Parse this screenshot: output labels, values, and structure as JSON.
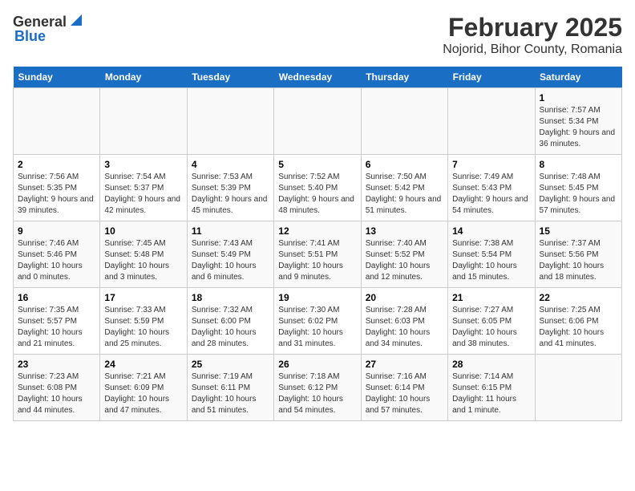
{
  "header": {
    "logo_general": "General",
    "logo_blue": "Blue",
    "title": "February 2025",
    "subtitle": "Nojorid, Bihor County, Romania"
  },
  "weekdays": [
    "Sunday",
    "Monday",
    "Tuesday",
    "Wednesday",
    "Thursday",
    "Friday",
    "Saturday"
  ],
  "weeks": [
    [
      {
        "day": "",
        "info": ""
      },
      {
        "day": "",
        "info": ""
      },
      {
        "day": "",
        "info": ""
      },
      {
        "day": "",
        "info": ""
      },
      {
        "day": "",
        "info": ""
      },
      {
        "day": "",
        "info": ""
      },
      {
        "day": "1",
        "info": "Sunrise: 7:57 AM\nSunset: 5:34 PM\nDaylight: 9 hours and 36 minutes."
      }
    ],
    [
      {
        "day": "2",
        "info": "Sunrise: 7:56 AM\nSunset: 5:35 PM\nDaylight: 9 hours and 39 minutes."
      },
      {
        "day": "3",
        "info": "Sunrise: 7:54 AM\nSunset: 5:37 PM\nDaylight: 9 hours and 42 minutes."
      },
      {
        "day": "4",
        "info": "Sunrise: 7:53 AM\nSunset: 5:39 PM\nDaylight: 9 hours and 45 minutes."
      },
      {
        "day": "5",
        "info": "Sunrise: 7:52 AM\nSunset: 5:40 PM\nDaylight: 9 hours and 48 minutes."
      },
      {
        "day": "6",
        "info": "Sunrise: 7:50 AM\nSunset: 5:42 PM\nDaylight: 9 hours and 51 minutes."
      },
      {
        "day": "7",
        "info": "Sunrise: 7:49 AM\nSunset: 5:43 PM\nDaylight: 9 hours and 54 minutes."
      },
      {
        "day": "8",
        "info": "Sunrise: 7:48 AM\nSunset: 5:45 PM\nDaylight: 9 hours and 57 minutes."
      }
    ],
    [
      {
        "day": "9",
        "info": "Sunrise: 7:46 AM\nSunset: 5:46 PM\nDaylight: 10 hours and 0 minutes."
      },
      {
        "day": "10",
        "info": "Sunrise: 7:45 AM\nSunset: 5:48 PM\nDaylight: 10 hours and 3 minutes."
      },
      {
        "day": "11",
        "info": "Sunrise: 7:43 AM\nSunset: 5:49 PM\nDaylight: 10 hours and 6 minutes."
      },
      {
        "day": "12",
        "info": "Sunrise: 7:41 AM\nSunset: 5:51 PM\nDaylight: 10 hours and 9 minutes."
      },
      {
        "day": "13",
        "info": "Sunrise: 7:40 AM\nSunset: 5:52 PM\nDaylight: 10 hours and 12 minutes."
      },
      {
        "day": "14",
        "info": "Sunrise: 7:38 AM\nSunset: 5:54 PM\nDaylight: 10 hours and 15 minutes."
      },
      {
        "day": "15",
        "info": "Sunrise: 7:37 AM\nSunset: 5:56 PM\nDaylight: 10 hours and 18 minutes."
      }
    ],
    [
      {
        "day": "16",
        "info": "Sunrise: 7:35 AM\nSunset: 5:57 PM\nDaylight: 10 hours and 21 minutes."
      },
      {
        "day": "17",
        "info": "Sunrise: 7:33 AM\nSunset: 5:59 PM\nDaylight: 10 hours and 25 minutes."
      },
      {
        "day": "18",
        "info": "Sunrise: 7:32 AM\nSunset: 6:00 PM\nDaylight: 10 hours and 28 minutes."
      },
      {
        "day": "19",
        "info": "Sunrise: 7:30 AM\nSunset: 6:02 PM\nDaylight: 10 hours and 31 minutes."
      },
      {
        "day": "20",
        "info": "Sunrise: 7:28 AM\nSunset: 6:03 PM\nDaylight: 10 hours and 34 minutes."
      },
      {
        "day": "21",
        "info": "Sunrise: 7:27 AM\nSunset: 6:05 PM\nDaylight: 10 hours and 38 minutes."
      },
      {
        "day": "22",
        "info": "Sunrise: 7:25 AM\nSunset: 6:06 PM\nDaylight: 10 hours and 41 minutes."
      }
    ],
    [
      {
        "day": "23",
        "info": "Sunrise: 7:23 AM\nSunset: 6:08 PM\nDaylight: 10 hours and 44 minutes."
      },
      {
        "day": "24",
        "info": "Sunrise: 7:21 AM\nSunset: 6:09 PM\nDaylight: 10 hours and 47 minutes."
      },
      {
        "day": "25",
        "info": "Sunrise: 7:19 AM\nSunset: 6:11 PM\nDaylight: 10 hours and 51 minutes."
      },
      {
        "day": "26",
        "info": "Sunrise: 7:18 AM\nSunset: 6:12 PM\nDaylight: 10 hours and 54 minutes."
      },
      {
        "day": "27",
        "info": "Sunrise: 7:16 AM\nSunset: 6:14 PM\nDaylight: 10 hours and 57 minutes."
      },
      {
        "day": "28",
        "info": "Sunrise: 7:14 AM\nSunset: 6:15 PM\nDaylight: 11 hours and 1 minute."
      },
      {
        "day": "",
        "info": ""
      }
    ]
  ]
}
